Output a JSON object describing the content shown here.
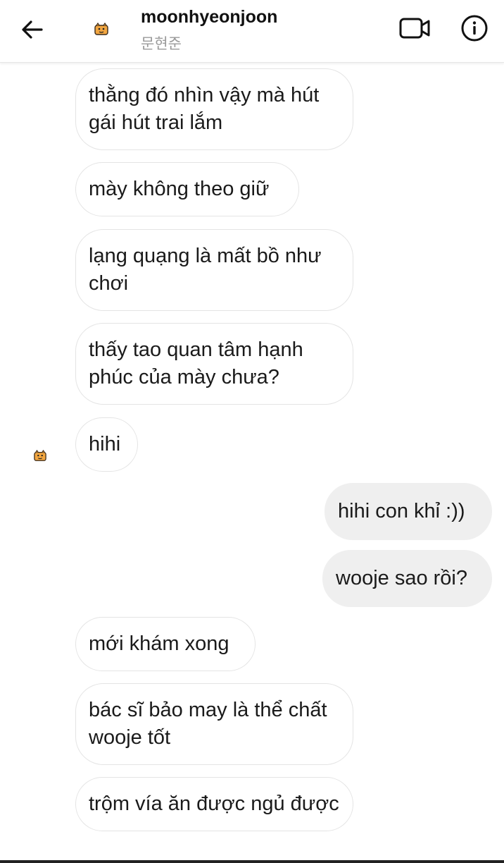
{
  "header": {
    "back_icon": "arrow-left-icon",
    "username": "moonhyeonjoon",
    "display_name": "문현준",
    "avatar_icon": "tiger-sticker-avatar",
    "video_icon": "video-camera-icon",
    "info_icon": "info-circle-icon"
  },
  "messages": [
    {
      "direction": "received",
      "text": "thằng đó nhìn vậy mà hút gái hút trai lắm"
    },
    {
      "direction": "received",
      "text": "mày không theo giữ"
    },
    {
      "direction": "received",
      "text": "lạng quạng là mất bồ như chơi"
    },
    {
      "direction": "received",
      "text": "thấy tao quan tâm hạnh phúc của mày chưa?"
    },
    {
      "direction": "received",
      "text": "hihi"
    },
    {
      "direction": "sent",
      "text": "hihi con khỉ :))"
    },
    {
      "direction": "sent",
      "text": "wooje sao rồi?"
    },
    {
      "direction": "received",
      "text": "mới khám xong"
    },
    {
      "direction": "received",
      "text": "bác sĩ bảo may là thể chất wooje tốt"
    },
    {
      "direction": "received",
      "text": "trộm vía ăn được ngủ được"
    }
  ],
  "colors": {
    "received_bubble_bg": "#ffffff",
    "received_bubble_border": "#e4e4e4",
    "sent_bubble_bg": "#efefef",
    "text": "#1a1a1a",
    "subtext": "#9a9a9a"
  }
}
